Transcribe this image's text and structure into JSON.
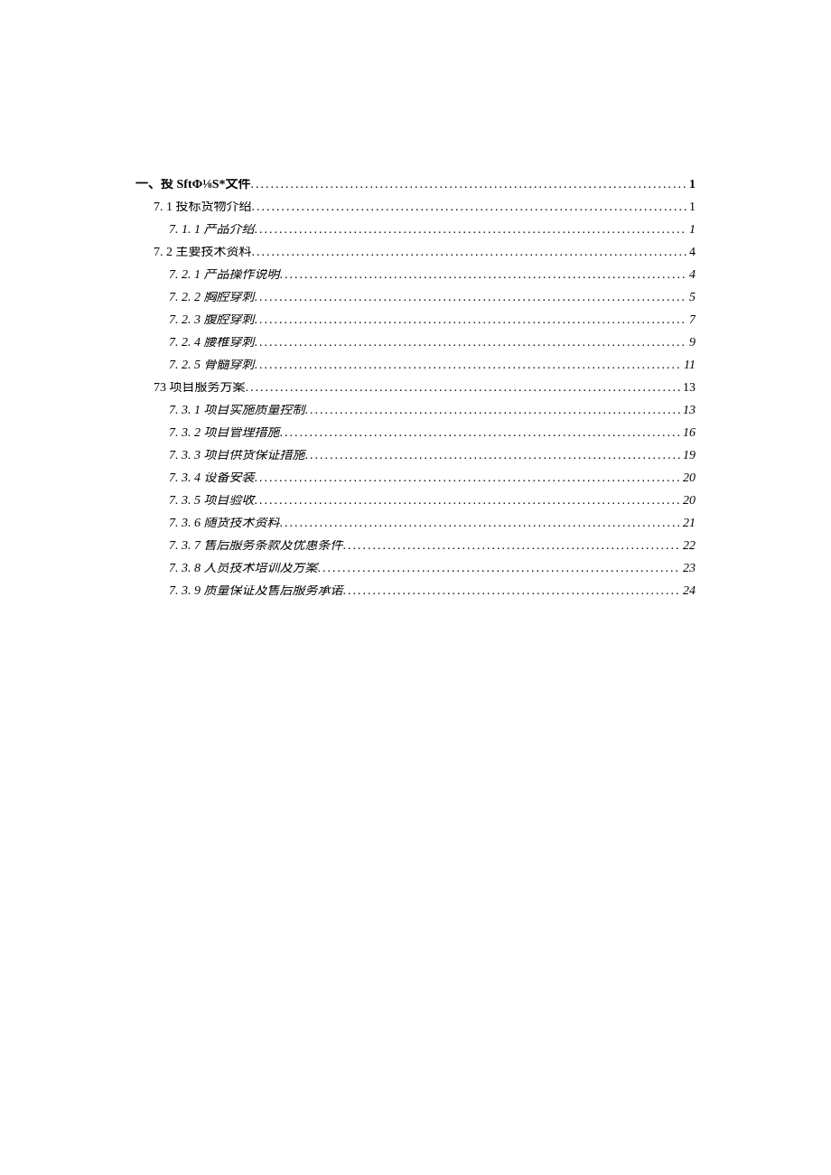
{
  "toc": [
    {
      "level": 1,
      "label": "一、投 SftΦ⅛S*文件",
      "page": "1",
      "bold": true
    },
    {
      "level": 2,
      "label": "7. 1  投标货物介绍",
      "page": "1"
    },
    {
      "level": 3,
      "label": "7. 1. 1  产品介绍",
      "page": "1"
    },
    {
      "level": 2,
      "label": "7. 2  主要技术资料",
      "page": "4"
    },
    {
      "level": 3,
      "label": "7. 2. 1  产品操作说明",
      "page": "4"
    },
    {
      "level": 3,
      "label": "7. 2. 2  胸腔穿刺",
      "page": "5"
    },
    {
      "level": 3,
      "label": "7. 2. 3  腹腔穿刺",
      "page": "7"
    },
    {
      "level": 3,
      "label": "7. 2. 4  腰椎穿刺",
      "page": "9"
    },
    {
      "level": 3,
      "label": "7. 2. 5  骨髓穿刺",
      "page": "11"
    },
    {
      "level": 2,
      "label": "73 项目服务方案",
      "page": "13"
    },
    {
      "level": 3,
      "label": "7. 3. 1  项目实施质量控制",
      "page": "13"
    },
    {
      "level": 3,
      "label": "7. 3. 2  项目管理措施",
      "page": "16"
    },
    {
      "level": 3,
      "label": "7. 3. 3  项目供货保证措施",
      "page": "19"
    },
    {
      "level": 3,
      "label": "7. 3. 4  设备安装",
      "page": "20"
    },
    {
      "level": 3,
      "label": "7. 3. 5  项目验收",
      "page": "20"
    },
    {
      "level": 3,
      "label": "7. 3. 6  随货技术资料",
      "page": "21"
    },
    {
      "level": 3,
      "label": "7. 3. 7  售后服务条款及优惠条件",
      "page": "22"
    },
    {
      "level": 3,
      "label": "7. 3. 8  人员技术培训及方案",
      "page": "23"
    },
    {
      "level": 3,
      "label": "7. 3. 9  质量保证及售后服务承诺",
      "page": "24"
    }
  ]
}
